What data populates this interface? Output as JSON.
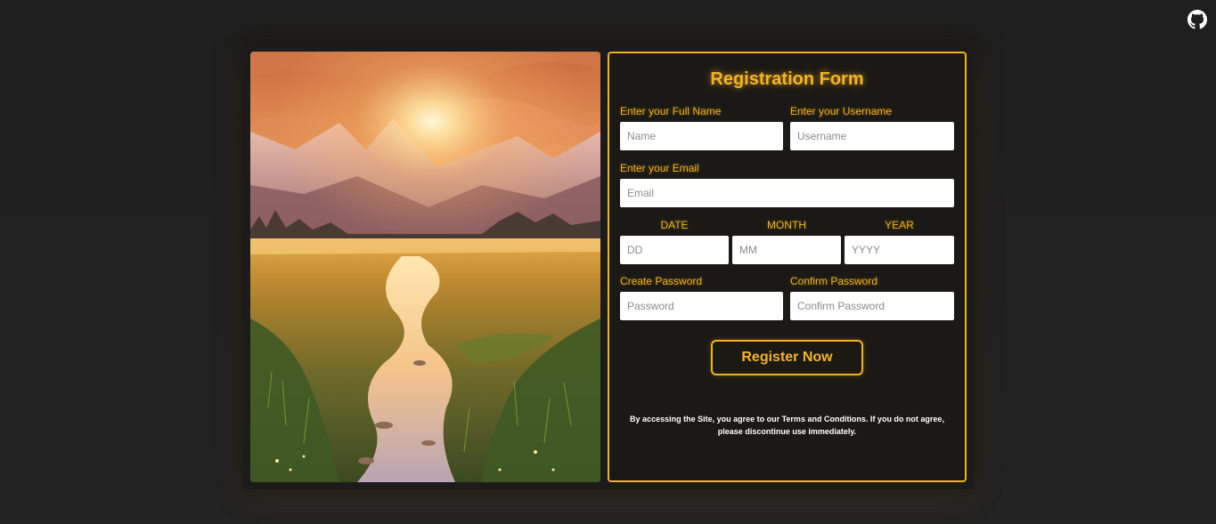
{
  "page": {
    "github_icon": "github-icon"
  },
  "form": {
    "title": "Registration Form",
    "fullname": {
      "label": "Enter your Full Name",
      "placeholder": "Name"
    },
    "username": {
      "label": "Enter your Username",
      "placeholder": "Username"
    },
    "email": {
      "label": "Enter your Email",
      "placeholder": "Email"
    },
    "date": {
      "label": "DATE",
      "placeholder": "DD"
    },
    "month": {
      "label": "MONTH",
      "placeholder": "MM"
    },
    "year": {
      "label": "YEAR",
      "placeholder": "YYYY"
    },
    "password": {
      "label": "Create Password",
      "placeholder": "Password"
    },
    "confirm_password": {
      "label": "Confirm Password",
      "placeholder": "Confirm Password"
    },
    "submit_label": "Register Now",
    "terms_text": "By accessing the Site, you agree to our Terms and Conditions. If you do not agree, please discontinue use immediately."
  },
  "colors": {
    "accent": "#f2b31b",
    "background": "#212121",
    "panel": "#1b1916"
  }
}
